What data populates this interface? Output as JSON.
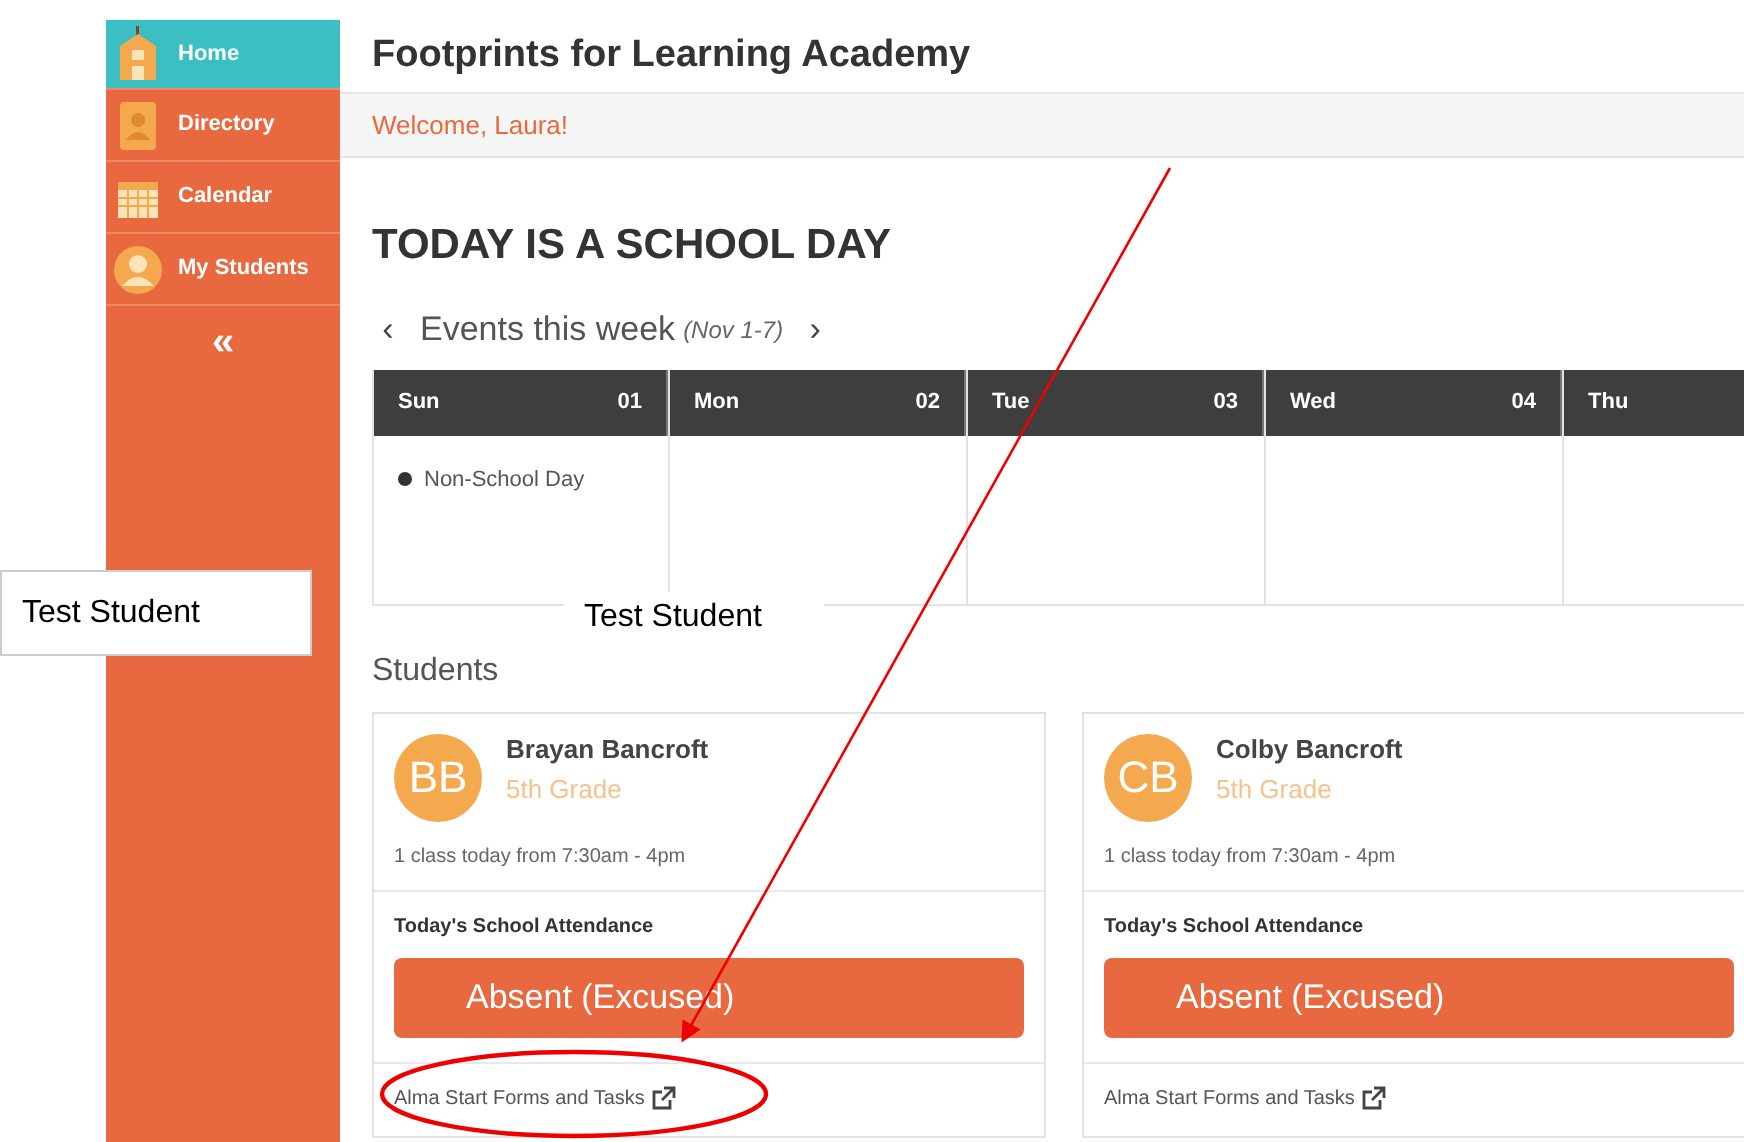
{
  "sidebar": {
    "items": [
      {
        "label": "Home",
        "selected": true
      },
      {
        "label": "Directory",
        "selected": false
      },
      {
        "label": "Calendar",
        "selected": false
      },
      {
        "label": "My Students",
        "selected": false
      }
    ],
    "collapse": "«"
  },
  "header": {
    "title": "Footprints for Learning Academy",
    "welcome": "Welcome, Laura!"
  },
  "heading": "TODAY IS A SCHOOL DAY",
  "events": {
    "prev": "‹",
    "title": "Events this week",
    "range": "(Nov 1-7)",
    "next": "›",
    "days": [
      {
        "day": "Sun",
        "date": "01",
        "events": [
          "Non-School Day"
        ]
      },
      {
        "day": "Mon",
        "date": "02"
      },
      {
        "day": "Tue",
        "date": "03"
      },
      {
        "day": "Wed",
        "date": "04"
      },
      {
        "day": "Thu"
      }
    ]
  },
  "students_title": "Students",
  "students": [
    {
      "initials": "BB",
      "name": "Brayan Bancroft",
      "grade": "5th Grade",
      "schedule": "1 class today from 7:30am - 4pm",
      "attendance_label": "Today's School Attendance",
      "attendance": "Absent (Excused)",
      "link": "Alma Start Forms and Tasks"
    },
    {
      "initials": "CB",
      "name": "Colby Bancroft",
      "grade": "5th Grade",
      "schedule": "1 class today from 7:30am - 4pm",
      "attendance_label": "Today's School Attendance",
      "attendance": "Absent (Excused)",
      "link": "Alma Start Forms and Tasks"
    }
  ],
  "annotations": {
    "labels": [
      "Test Student",
      "Test Student"
    ]
  }
}
